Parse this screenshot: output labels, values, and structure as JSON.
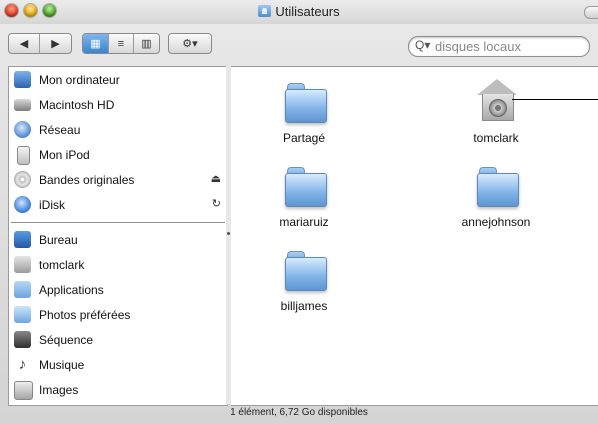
{
  "window": {
    "title": "Utilisateurs"
  },
  "toolbar": {
    "back_glyph": "◀",
    "forward_glyph": "▶",
    "view_icon_glyph": "▦",
    "view_list_glyph": "≡",
    "view_column_glyph": "▥",
    "action_glyph": "⚙▾",
    "search_glyph": "Q▾",
    "search_placeholder": "disques locaux"
  },
  "sidebar": {
    "devices": [
      {
        "label": "Mon ordinateur",
        "icon": "computer-icon",
        "color": "#3a78c8"
      },
      {
        "label": "Macintosh HD",
        "icon": "hard-disk-icon",
        "color": "#8a8a8a"
      },
      {
        "label": "Réseau",
        "icon": "network-icon",
        "color": "#5a8ed6"
      },
      {
        "label": "Mon iPod",
        "icon": "ipod-icon",
        "color": "#cfcfcf"
      },
      {
        "label": "Bandes originales",
        "icon": "cd-icon",
        "color": "#c9c9c9",
        "accessory": "⏏"
      },
      {
        "label": "iDisk",
        "icon": "idisk-icon",
        "color": "#4b92e0",
        "accessory": "↻"
      }
    ],
    "places": [
      {
        "label": "Bureau",
        "icon": "desktop-icon",
        "color": "#3d7fd0"
      },
      {
        "label": "tomclark",
        "icon": "home-icon",
        "color": "#a0a0a0"
      },
      {
        "label": "Applications",
        "icon": "applications-icon",
        "color": "#7fb2e6"
      },
      {
        "label": "Photos préférées",
        "icon": "folder-icon",
        "color": "#8cbbea"
      },
      {
        "label": "Séquence",
        "icon": "movies-icon",
        "color": "#555555"
      },
      {
        "label": "Musique",
        "icon": "music-icon",
        "color": "#333333"
      },
      {
        "label": "Images",
        "icon": "pictures-icon",
        "color": "#9a9a9a"
      }
    ]
  },
  "files": [
    {
      "name": "Partagé",
      "kind": "folder"
    },
    {
      "name": "tomclark",
      "kind": "home"
    },
    {
      "name": "mariaruiz",
      "kind": "folder"
    },
    {
      "name": "annejohnson",
      "kind": "folder"
    },
    {
      "name": "billjames",
      "kind": "folder"
    }
  ],
  "status": "1 élément, 6,72 Go disponibles"
}
